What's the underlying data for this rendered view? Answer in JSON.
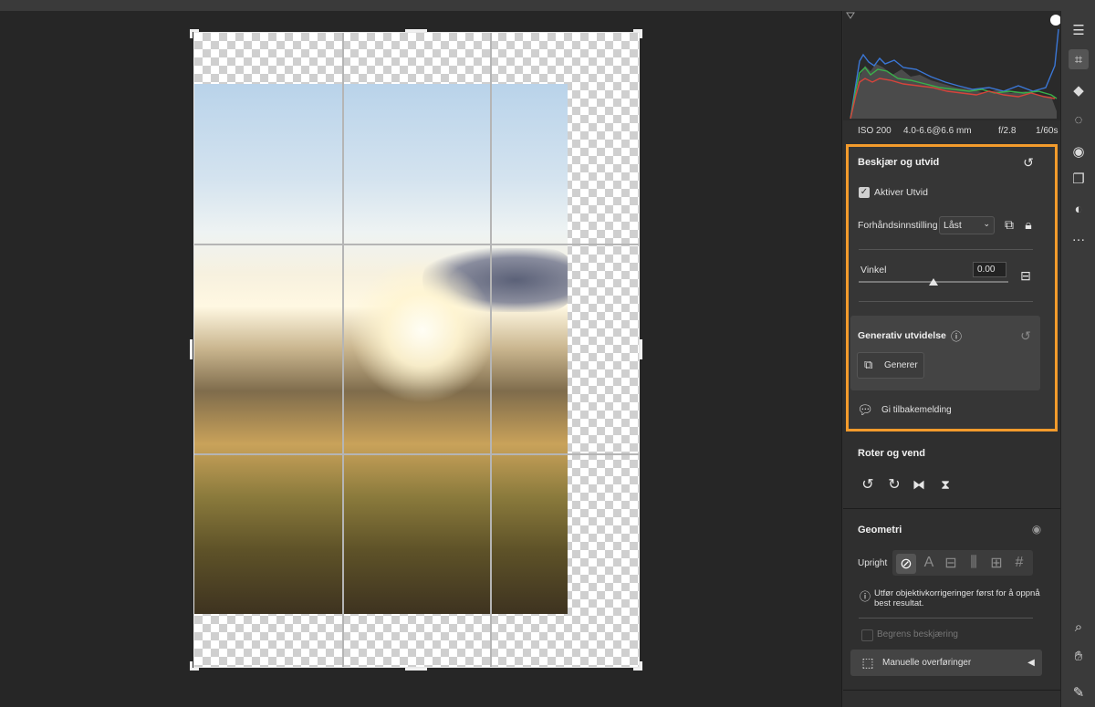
{
  "exif": {
    "iso": "ISO 200",
    "lens": "4.0-6.6@6.6 mm",
    "aperture": "f/2.8",
    "shutter": "1/60s"
  },
  "crop": {
    "title": "Beskjær og utvid",
    "enable_expand_label": "Aktiver Utvid",
    "enable_expand_checked": true,
    "preset_label": "Forhåndsinnstilling",
    "preset_value": "Låst",
    "angle_label": "Vinkel",
    "angle_value": "0.00",
    "angle_slider": 0.5,
    "generative": {
      "title": "Generativ utvidelse",
      "generate_label": "Generer"
    },
    "feedback_label": "Gi tilbakemelding",
    "accent_color": "#f39b2c"
  },
  "rotate": {
    "title": "Roter og vend"
  },
  "geometry": {
    "title": "Geometri",
    "upright_label": "Upright",
    "info_text_1": "Utfør objektivkorrigeringer først for å oppnå",
    "info_text_2": "best resultat.",
    "constrain_label": "Begrens beskjæring",
    "manual_label": "Manuelle overføringer"
  },
  "tools": [
    "sliders-icon",
    "crop-icon",
    "eraser-icon",
    "healing-icon",
    "redeye-icon",
    "layers-icon",
    "presets-icon",
    "more-icon",
    "zoom-icon",
    "hand-icon",
    "eyedropper-icon"
  ]
}
